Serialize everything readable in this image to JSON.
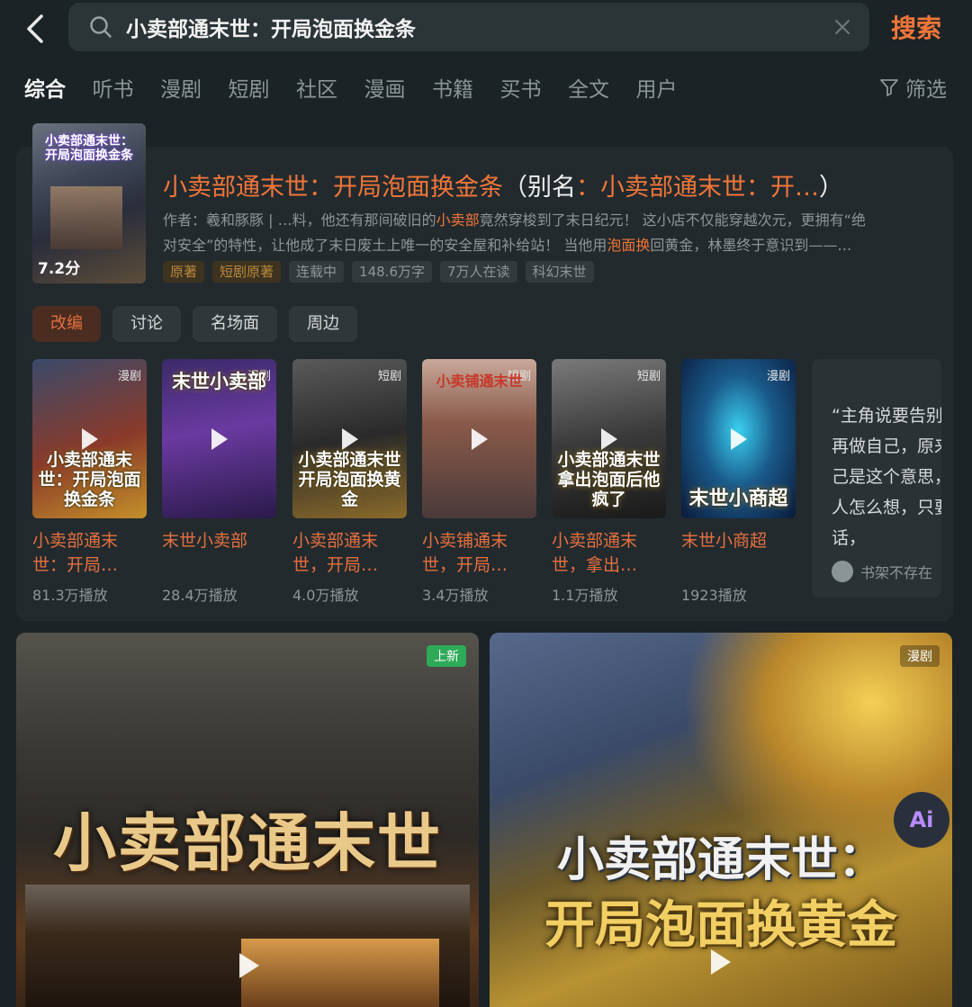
{
  "search": {
    "query": "小卖部通末世：开局泡面换金条",
    "button_label": "搜索"
  },
  "tabs": [
    {
      "label": "综合",
      "active": true
    },
    {
      "label": "听书"
    },
    {
      "label": "漫剧"
    },
    {
      "label": "短剧"
    },
    {
      "label": "社区"
    },
    {
      "label": "漫画"
    },
    {
      "label": "书籍"
    },
    {
      "label": "买书"
    },
    {
      "label": "全文"
    },
    {
      "label": "用户"
    }
  ],
  "filter_label": "筛选",
  "book": {
    "cover_title": "小卖部通末世：开局泡面换金条",
    "score": "7.2分",
    "title_part1": "小卖部通末世：开局泡面换金条",
    "title_part2": "（别名",
    "title_part3": "：小卖部通末世：开…",
    "title_part4": "）",
    "desc_line1_a": "作者：羲和豚豚 | …料，他还有那间破旧的",
    "desc_line1_hl": "小卖部",
    "desc_line1_b": "竟然穿梭到了末日纪元！ 这小店不仅能穿越次元，更拥有“绝",
    "desc_line2_a": "对安全”的特性，让他成了末日废土上唯一的安全屋和补给站！ 当他用",
    "desc_line2_hl": "泡面换",
    "desc_line2_b": "回黄金，林墨终于意识到——…",
    "tags": [
      {
        "label": "原著",
        "style": "orange"
      },
      {
        "label": "短剧原著",
        "style": "orange"
      },
      {
        "label": "连载中"
      },
      {
        "label": "148.6万字"
      },
      {
        "label": "7万人在读"
      },
      {
        "label": "科幻末世"
      }
    ],
    "subtabs": [
      {
        "label": "改编",
        "active": true
      },
      {
        "label": "讨论"
      },
      {
        "label": "名场面"
      },
      {
        "label": "周边"
      }
    ]
  },
  "videos": [
    {
      "badge": "漫剧",
      "thumb_title": "小卖部通末世：开局泡面换金条",
      "name": "小卖部通末世：开局…",
      "plays": "81.3万播放"
    },
    {
      "badge": "漫剧",
      "thumb_title": "末世小卖部",
      "name": "末世小卖部",
      "plays": "28.4万播放"
    },
    {
      "badge": "短剧",
      "thumb_title": "小卖部通末世 开局泡面换黄金",
      "name": "小卖部通末世，开局…",
      "plays": "4.0万播放"
    },
    {
      "badge": "短剧",
      "thumb_title": "小卖铺通末世",
      "name": "小卖铺通末世，开局…",
      "plays": "3.4万播放"
    },
    {
      "badge": "短剧",
      "thumb_title": "小卖部通末世 拿出泡面后他疯了",
      "name": "小卖部通末世，拿出…",
      "plays": "1.1万播放"
    },
    {
      "badge": "漫剧",
      "thumb_title": "末世小商超",
      "name": "末世小商超",
      "plays": "1923播放"
    }
  ],
  "quote": {
    "text": "“主角说要告别过去，不再做自己，原来告别自己是这个意思，不管别人怎么想，只要不说话，",
    "user": "书架不存在"
  },
  "tiles": [
    {
      "badge": "上新",
      "title": "小卖部通末世"
    },
    {
      "badge": "漫剧",
      "title_line1": "小卖部通末世：",
      "title_line2": "开局泡面换黄金"
    }
  ],
  "ai_label": "Ai"
}
